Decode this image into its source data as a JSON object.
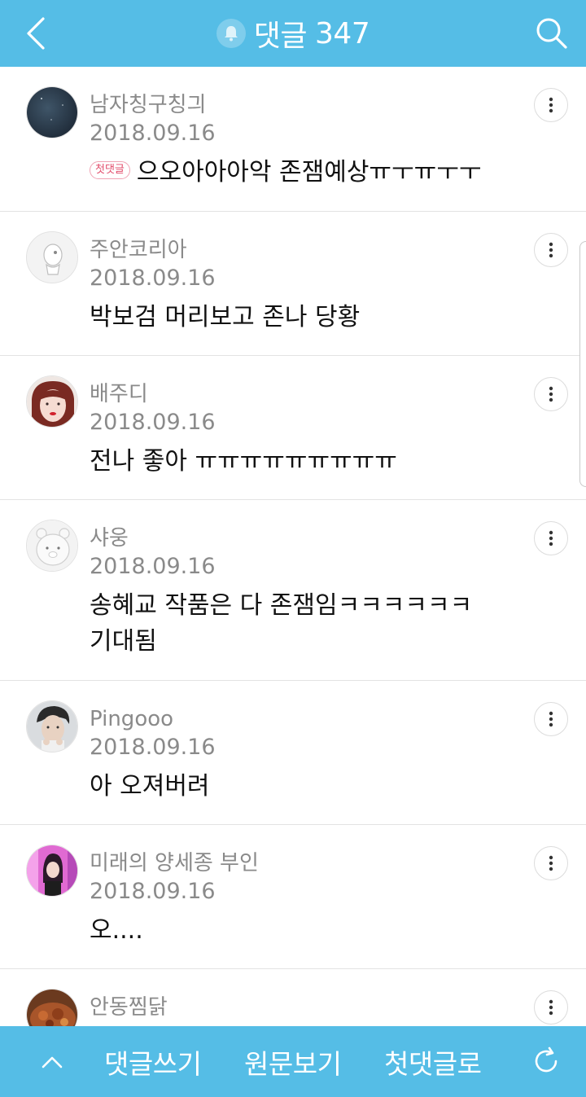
{
  "header": {
    "title": "댓글",
    "count": "347",
    "icons": {
      "back": "chevron-left-icon",
      "bell": "bell-icon",
      "search": "search-icon"
    },
    "colors": {
      "bar": "#55bde6"
    }
  },
  "comments": [
    {
      "author": "남자칭구칭긔",
      "date": "2018.09.16",
      "badge": "첫댓글",
      "text": "으오아아아악 존잼예상ㅠㅜㅠㅜㅜ",
      "avatar": "night-sky-avatar"
    },
    {
      "author": "주안코리아",
      "date": "2018.09.16",
      "text": "박보검 머리보고 존나 당황",
      "avatar": "character-avatar"
    },
    {
      "author": "배주디",
      "date": "2018.09.16",
      "text": "전나 좋아 ㅠㅠㅠㅠㅠㅠㅠㅠㅠ",
      "avatar": "girl-avatar"
    },
    {
      "author": "샤웅",
      "date": "2018.09.16",
      "text": "송혜교 작품은 다 존잼임ㅋㅋㅋㅋㅋㅋ",
      "text2": "기대됨",
      "avatar": "bear-avatar"
    },
    {
      "author": "Pingooo",
      "date": "2018.09.16",
      "text": "아 오져버려",
      "avatar": "man-avatar"
    },
    {
      "author": "미래의 양세종 부인",
      "date": "2018.09.16",
      "text": "오....",
      "avatar": "pink-avatar"
    },
    {
      "author": "안동찜닭",
      "date": "",
      "text": "",
      "avatar": "food-avatar"
    }
  ],
  "footer": {
    "write": "댓글쓰기",
    "original": "원문보기",
    "first": "첫댓글로",
    "icons": {
      "up": "chevron-up-icon",
      "refresh": "refresh-icon"
    }
  }
}
